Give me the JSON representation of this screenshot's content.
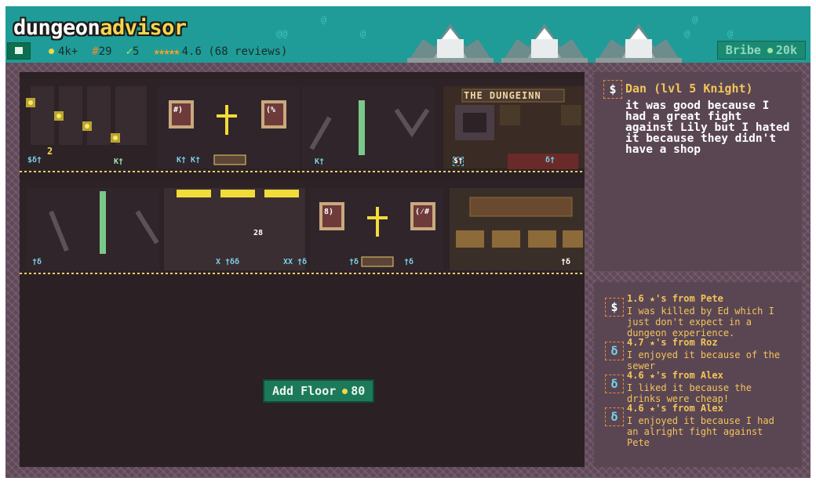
{
  "header": {
    "logo_part1": "dungeon",
    "logo_part2": "advisor",
    "stats": {
      "gold": "4k+",
      "rooms": "29",
      "checks": "5",
      "rating_stars": "★★★★★",
      "rating": "4.6 (68 reviews)"
    },
    "bribe_label": "Bribe",
    "bribe_cost": "20k"
  },
  "dungeon": {
    "sign_text": "THE DUNGEINN",
    "kill_count": "28",
    "party_count": "2",
    "add_floor_label": "Add Floor",
    "add_floor_cost": "80"
  },
  "featured_review": {
    "avatar": "$",
    "name": "Dan (lvl 5 Knight)",
    "text": "it was good because I had a great fight against Lily but I hated it because they didn't have a shop"
  },
  "reviews": [
    {
      "avatar": "$",
      "header": "1.6 ★'s from Pete",
      "text": "I was killed by Ed which I just don't expect in a dungeon experience."
    },
    {
      "avatar": "δ",
      "header": "4.7 ★'s from Roz",
      "text": "I enjoyed it because of the sewer"
    },
    {
      "avatar": "δ",
      "header": "4.6 ★'s from Alex",
      "text": "I liked it because the drinks were cheap!"
    },
    {
      "avatar": "δ",
      "header": "4.6 ★'s from Alex",
      "text": "I enjoyed it because I had an alright fight against Pete"
    }
  ],
  "colors": {
    "header": "#1f9c97",
    "panel": "#5a4653",
    "accent_gold": "#f3d64e",
    "accent_orange": "#f08a32",
    "button_green": "#1c7a5a"
  }
}
